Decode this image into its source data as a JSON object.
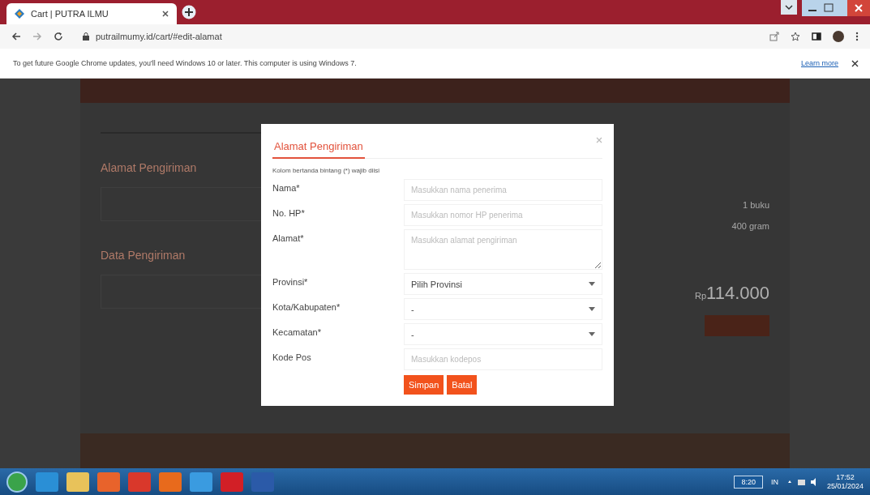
{
  "browser": {
    "tab_title": "Cart | PUTRA ILMU",
    "url": "putrailmumy.id/cart/#edit-alamat"
  },
  "infobar": {
    "message": "To get future Google Chrome updates, you'll need Windows 10 or later. This computer is using Windows 7.",
    "link": "Learn more"
  },
  "page": {
    "left_headings": [
      "Alamat Pengiriman",
      "Data Pengiriman"
    ],
    "summary": [
      "1 buku",
      "400 gram"
    ],
    "total_currency": "Rp",
    "total": "114.000"
  },
  "modal": {
    "title": "Alamat Pengiriman",
    "note": "Kolom bertanda bintang (*) wajib diisi",
    "fields": [
      {
        "kind": "text",
        "label": "Nama*",
        "placeholder": "Masukkan nama penerima"
      },
      {
        "kind": "text",
        "label": "No. HP*",
        "placeholder": "Masukkan nomor HP penerima"
      },
      {
        "kind": "textarea",
        "label": "Alamat*",
        "placeholder": "Masukkan alamat pengiriman"
      },
      {
        "kind": "select",
        "label": "Provinsi*",
        "value": "Pilih Provinsi"
      },
      {
        "kind": "select",
        "label": "Kota/Kabupaten*",
        "value": "-"
      },
      {
        "kind": "select",
        "label": "Kecamatan*",
        "value": "-"
      },
      {
        "kind": "text",
        "label": "Kode Pos",
        "placeholder": "Masukkan kodepos"
      }
    ],
    "buttons": [
      "Simpan",
      "Batal"
    ]
  },
  "taskbar": {
    "apps": [
      {
        "kind": "explorer"
      },
      {
        "kind": "folder"
      },
      {
        "kind": "media"
      },
      {
        "kind": "chrome"
      },
      {
        "kind": "firefox"
      },
      {
        "kind": "ie"
      },
      {
        "kind": "opera"
      },
      {
        "kind": "word"
      }
    ],
    "battery": "8:20",
    "language": "IN",
    "time": "17:52",
    "date": "25/01/2024"
  }
}
